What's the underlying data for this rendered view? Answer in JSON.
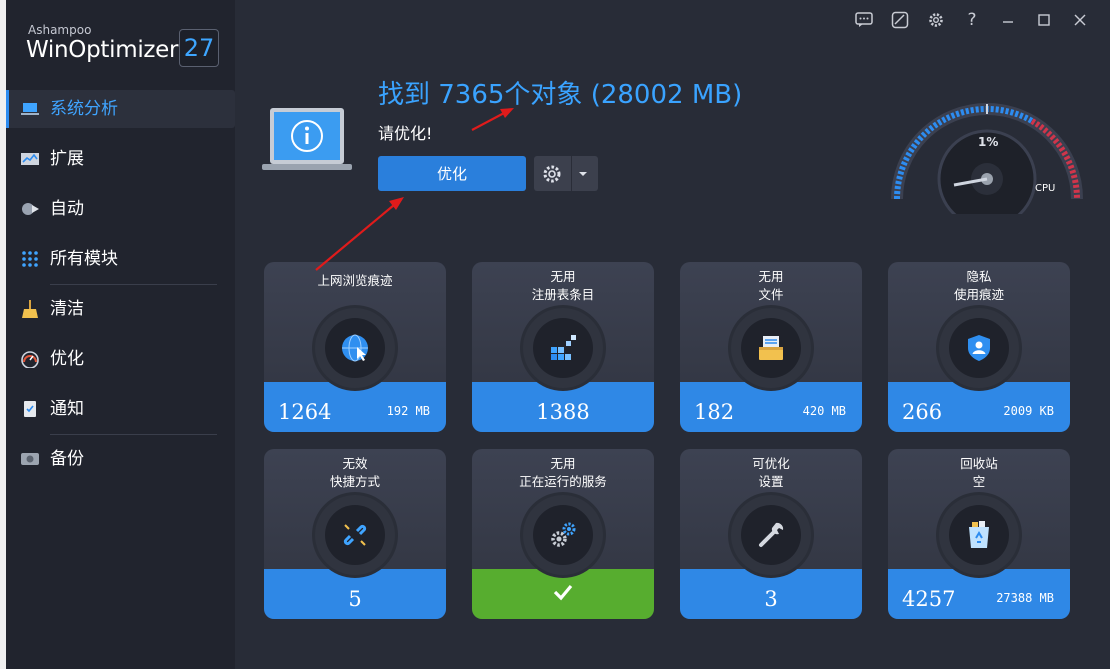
{
  "app": {
    "brand_small": "Ashampoo",
    "brand_name": "WinOptimizer",
    "version": "27",
    "accent": "#2d8cf0"
  },
  "titlebar": {
    "icons": [
      "feedback-icon",
      "theme-icon",
      "settings-icon",
      "help-icon",
      "minimize-icon",
      "maximize-icon",
      "close-icon"
    ],
    "help_label": "?"
  },
  "sidebar": {
    "items": [
      {
        "label": "系统分析",
        "icon": "laptop-icon",
        "active": true
      },
      {
        "label": "扩展",
        "icon": "chart-icon"
      },
      {
        "label": "自动",
        "icon": "auto-icon"
      },
      {
        "label": "所有模块",
        "icon": "grid-icon"
      },
      {
        "label": "清洁",
        "icon": "broom-icon"
      },
      {
        "label": "优化",
        "icon": "speed-icon"
      },
      {
        "label": "通知",
        "icon": "notification-icon"
      },
      {
        "label": "备份",
        "icon": "backup-icon"
      }
    ]
  },
  "header": {
    "headline": "找到 7365个对象 (28002 MB)",
    "subline": "请优化!",
    "optimize_label": "优化"
  },
  "gauge": {
    "value_label": "1%",
    "value": 1,
    "unit_label": "CPU"
  },
  "tiles": [
    {
      "title": "上网浏览痕迹",
      "count": "1264",
      "size": "192 MB",
      "icon": "globe-cursor-icon"
    },
    {
      "title": "无用\n注册表条目",
      "count": "1388",
      "size": "",
      "icon": "registry-blocks-icon"
    },
    {
      "title": "无用\n文件",
      "count": "182",
      "size": "420 MB",
      "icon": "file-folder-icon"
    },
    {
      "title": "隐私\n使用痕迹",
      "count": "266",
      "size": "2009 KB",
      "icon": "privacy-shield-icon"
    },
    {
      "title": "无效\n快捷方式",
      "count": "5",
      "size": "",
      "icon": "broken-link-icon"
    },
    {
      "title": "无用\n正在运行的服务",
      "count": "",
      "size": "",
      "icon": "gears-icon",
      "status": "ok"
    },
    {
      "title": "可优化\n设置",
      "count": "3",
      "size": "",
      "icon": "wrench-icon"
    },
    {
      "title": "回收站\n空",
      "count": "4257",
      "size": "27388 MB",
      "icon": "recycle-bin-icon"
    }
  ]
}
